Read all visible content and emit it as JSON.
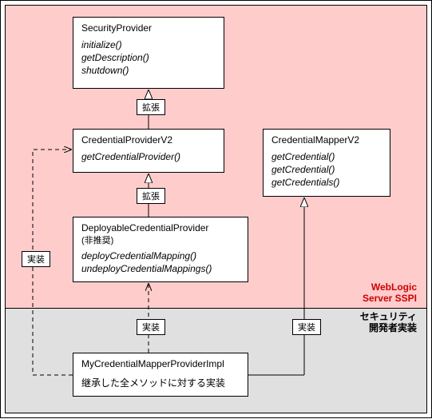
{
  "zones": {
    "top_label": "WebLogic\nServer SSPI",
    "bottom_label": "セキュリティ\n開発者実装"
  },
  "boxes": {
    "security_provider": {
      "title": "SecurityProvider",
      "methods": [
        "initialize()",
        "getDescription()",
        "shutdown()"
      ]
    },
    "credential_provider_v2": {
      "title": "CredentialProviderV2",
      "methods": [
        "getCredentialProvider()"
      ]
    },
    "deployable_credential_provider": {
      "title": "DeployableCredentialProvider",
      "subtitle": "(非推奨)",
      "methods": [
        "deployCredentialMapping()",
        "undeployCredentialMappings()"
      ]
    },
    "credential_mapper_v2": {
      "title": "CredentialMapperV2",
      "methods": [
        "getCredential()",
        "getCredential()",
        "getCredentials()"
      ]
    },
    "impl": {
      "title": "MyCredentialMapperProviderImpl",
      "note": "継承した全メソッドに対する実装"
    }
  },
  "edges": {
    "extend1": "拡張",
    "extend2": "拡張",
    "impl1": "実装",
    "impl2": "実装",
    "impl3": "実装"
  }
}
